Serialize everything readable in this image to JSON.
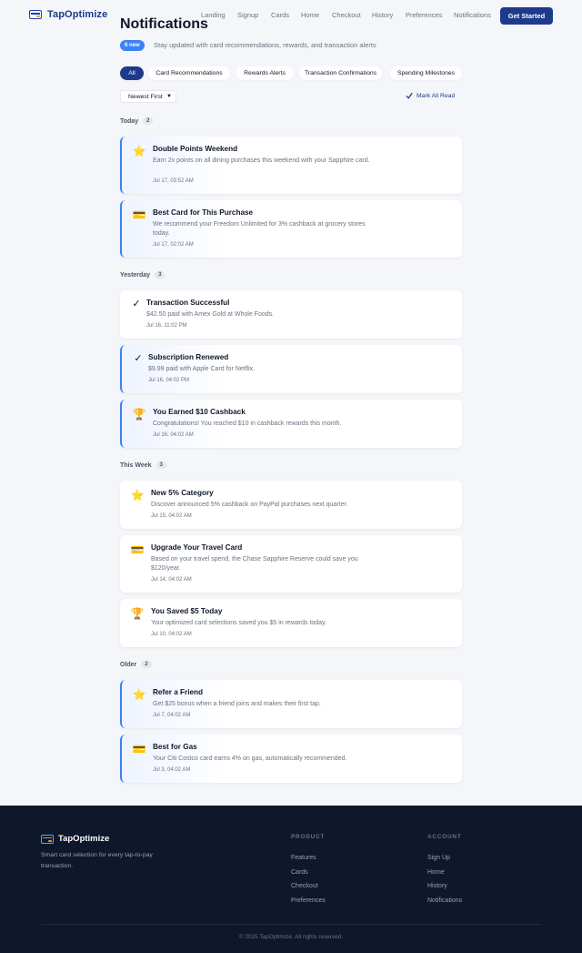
{
  "header": {
    "brand": "TapOptimize",
    "nav": [
      "Landing",
      "Signup",
      "Cards",
      "Home",
      "Checkout",
      "History",
      "Preferences",
      "Notifications"
    ],
    "cta": "Get Started"
  },
  "page": {
    "title": "Notifications",
    "new_badge": "6 new",
    "subtitle": "Stay updated with card recommendations, rewards, and transaction alerts"
  },
  "filters": [
    {
      "label": "All",
      "active": true
    },
    {
      "label": "Card Recommendations",
      "active": false
    },
    {
      "label": "Rewards Alerts",
      "active": false
    },
    {
      "label": "Transaction Confirmations",
      "active": false
    },
    {
      "label": "Spending Milestones",
      "active": false
    }
  ],
  "sort": {
    "value": "Newest First"
  },
  "mark_all_read": "Mark All Read",
  "groups": [
    {
      "label": "Today",
      "count": "2",
      "items": [
        {
          "icon": "star-icon",
          "title": "Double Points Weekend",
          "body": "Earn 2x points on all dining purchases this weekend with your Sapphire card.",
          "time": "Jul 17, 03:52 AM",
          "unread": true
        },
        {
          "icon": "credit-card-icon",
          "title": "Best Card for This Purchase",
          "body": "We recommend your Freedom Unlimited for 3% cashback at grocery stores today.",
          "time": "Jul 17, 02:02 AM",
          "unread": true
        }
      ]
    },
    {
      "label": "Yesterday",
      "count": "3",
      "items": [
        {
          "icon": "checkmark-icon",
          "title": "Transaction Successful",
          "body": "$42.50 paid with Amex Gold at Whole Foods.",
          "time": "Jul 16, 11:02 PM",
          "unread": false
        },
        {
          "icon": "checkmark-icon",
          "title": "Subscription Renewed",
          "body": "$9.99 paid with Apple Card for Netflix.",
          "time": "Jul 16, 04:02 PM",
          "unread": true
        },
        {
          "icon": "trophy-icon",
          "title": "You Earned $10 Cashback",
          "body": "Congratulations! You reached $10 in cashback rewards this month.",
          "time": "Jul 16, 04:02 AM",
          "unread": true
        }
      ]
    },
    {
      "label": "This Week",
      "count": "3",
      "items": [
        {
          "icon": "star-icon",
          "title": "New 5% Category",
          "body": "Discover announced 5% cashback on PayPal purchases next quarter.",
          "time": "Jul 15, 04:02 AM",
          "unread": false
        },
        {
          "icon": "credit-card-icon",
          "title": "Upgrade Your Travel Card",
          "body": "Based on your travel spend, the Chase Sapphire Reserve could save you $120/year.",
          "time": "Jul 14, 04:02 AM",
          "unread": false
        },
        {
          "icon": "trophy-icon",
          "title": "You Saved $5 Today",
          "body": "Your optimized card selections saved you $5 in rewards today.",
          "time": "Jul 10, 04:02 AM",
          "unread": false
        }
      ]
    },
    {
      "label": "Older",
      "count": "2",
      "items": [
        {
          "icon": "star-icon",
          "title": "Refer a Friend",
          "body": "Get $25 bonus when a friend joins and makes their first tap.",
          "time": "Jul 7, 04:02 AM",
          "unread": true
        },
        {
          "icon": "credit-card-icon",
          "title": "Best for Gas",
          "body": "Your Citi Costco card earns 4% on gas, automatically recommended.",
          "time": "Jul 3, 04:02 AM",
          "unread": true
        }
      ]
    }
  ],
  "footer": {
    "brand": "TapOptimize",
    "tagline": "Smart card selection for every tap-to-pay transaction.",
    "product_title": "PRODUCT",
    "product_links": [
      "Features",
      "Cards",
      "Checkout",
      "Preferences"
    ],
    "account_title": "ACCOUNT",
    "account_links": [
      "Sign Up",
      "Home",
      "History",
      "Notifications"
    ],
    "copyright": "© 2025 TapOptimize. All rights reserved."
  },
  "colors": {
    "brand": "#1e3a8a",
    "accent": "#3b82f6",
    "footer_bg": "#0f172a",
    "page_bg": "#f4f6f9"
  }
}
